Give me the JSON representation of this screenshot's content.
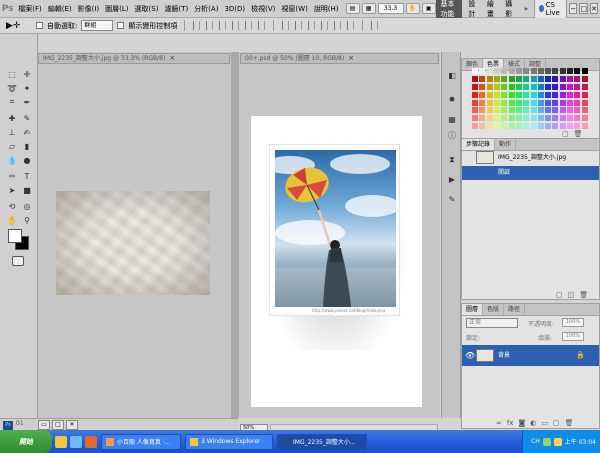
{
  "menubar": {
    "logo": "Ps",
    "items": [
      "檔案(F)",
      "編輯(E)",
      "影像(I)",
      "圖層(L)",
      "選取(S)",
      "濾鏡(T)",
      "分析(A)",
      "3D(D)",
      "檢視(V)",
      "視窗(W)",
      "說明(H)"
    ],
    "zoom": "33.3",
    "workspaces": {
      "active": "基本功能",
      "others": [
        "設計",
        "繪畫",
        "攝影"
      ],
      "more": "»"
    },
    "cslive": "CS Live",
    "window_controls": [
      "−",
      "□",
      "✕"
    ]
  },
  "options": {
    "auto_select_label": "自動選取:",
    "auto_select_value": "群組",
    "transform_label": "顯示變形控制項"
  },
  "documents": [
    {
      "tab": "IMG_2235_調整大小.jpg @ 33.3% (RGB/8)",
      "close": "×"
    },
    {
      "tab": "00+.psd @ 50% (圖層 10, RGB/8)",
      "close": "×",
      "zoom": "50%",
      "watermark": "http://www.pixnet.net/blog/mokuyou"
    }
  ],
  "panels": {
    "color_tabs": [
      "顏色",
      "色票",
      "樣式",
      "調整"
    ],
    "history_tabs": [
      "步驟記錄",
      "動作"
    ],
    "history_items": [
      {
        "label": "IMG_2235_調整大小.jpg"
      },
      {
        "label": "開啟"
      }
    ],
    "layers_tabs": [
      "圖層",
      "色版",
      "路徑"
    ],
    "blend_mode": "正常",
    "opacity_label": "不透明度:",
    "opacity_value": "100%",
    "lock_label": "鎖定:",
    "fill_label": "填滿:",
    "fill_value": "100%",
    "layer_name": "背景"
  },
  "statusbar": {
    "label": "01",
    "ps": "Ps"
  },
  "taskbar": {
    "start": "開始",
    "tasks": [
      "小百般 人像寫真 ·...",
      "3 Windows Explorer",
      "IMG_2235_調整大小..."
    ],
    "lang": "CH",
    "clock": "上午 03:04"
  },
  "colors": {
    "accent": "#2f5fb0",
    "taskbar": "#245edb"
  }
}
